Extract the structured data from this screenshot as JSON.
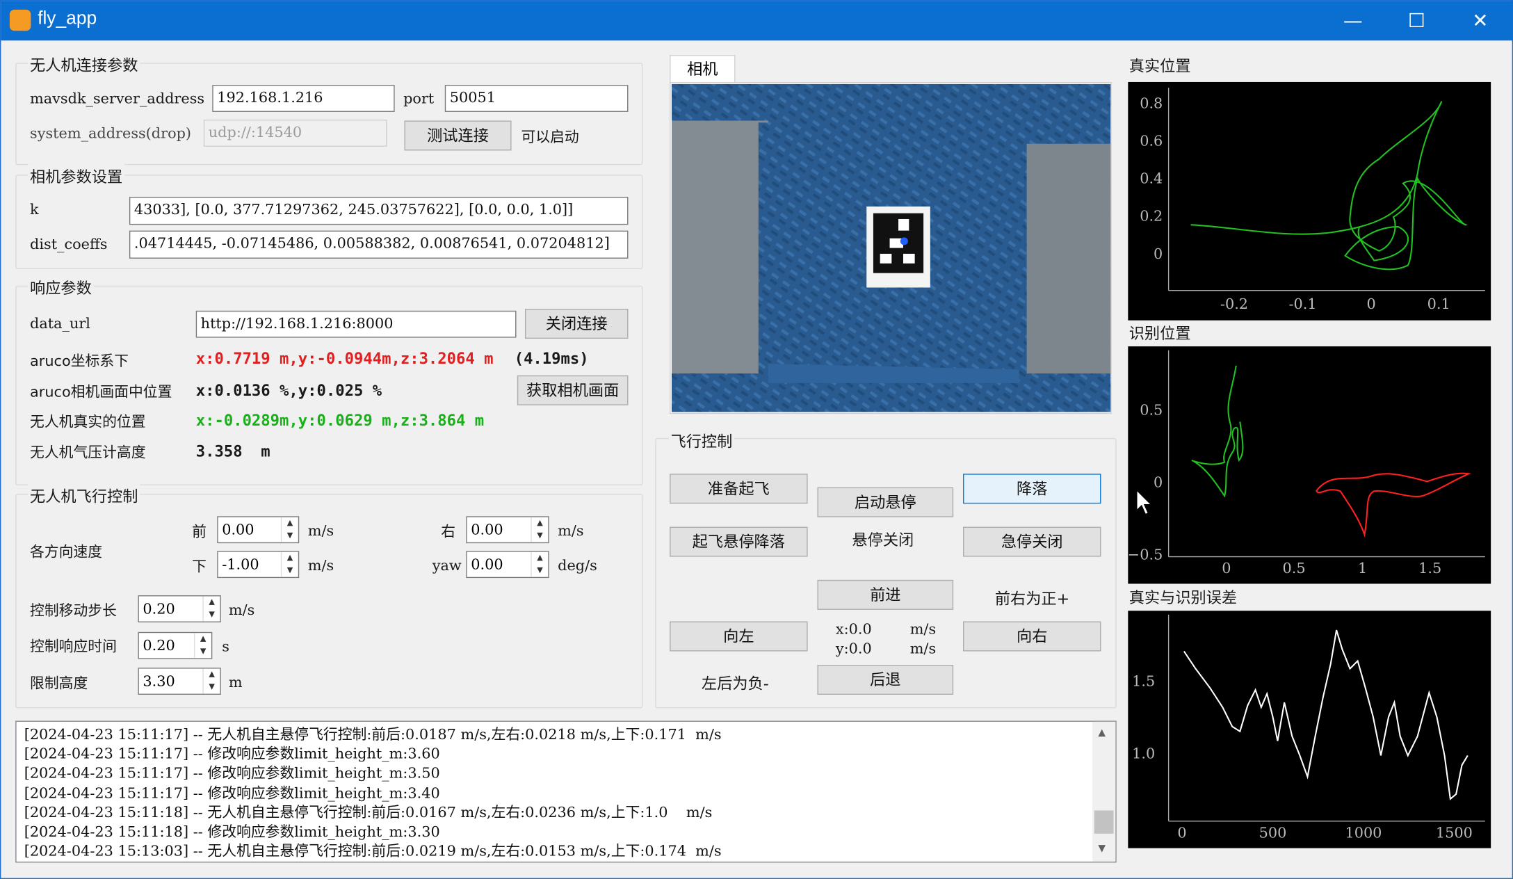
{
  "window": {
    "title": "fly_app",
    "minimize": "—",
    "maximize": "☐",
    "close": "✕"
  },
  "conn": {
    "group": "无人机连接参数",
    "server_label": "mavsdk_server_address",
    "server_value": "192.168.1.216",
    "port_label": "port",
    "port_value": "50051",
    "sys_label": "system_address(drop)",
    "sys_placeholder": "udp://:14540",
    "test_button": "测试连接",
    "status": "可以启动"
  },
  "camera_params": {
    "group": "相机参数设置",
    "k_label": "k",
    "k_value": "43033], [0.0, 377.71297362, 245.03757622], [0.0, 0.0, 1.0]]",
    "dist_label": "dist_coeffs",
    "dist_value": ".04714445, -0.07145486, 0.00588382, 0.00876541, 0.07204812]"
  },
  "response": {
    "group": "响应参数",
    "data_url_label": "data_url",
    "data_url_value": "http://192.168.1.216:8000",
    "close_button": "关闭连接",
    "aruco_label": "aruco坐标系下",
    "aruco_value": "x:0.7719 m,y:-0.0944m,z:3.2064 m",
    "aruco_time": "(4.19ms)",
    "aruco_cam_label": "aruco相机画面中位置",
    "aruco_cam_value": "x:0.0136 %,y:0.025  %",
    "get_image_button": "获取相机画面",
    "true_pos_label": "无人机真实的位置",
    "true_pos_value": "x:-0.0289m,y:0.0629 m,z:3.864 m",
    "baro_label": "无人机气压计高度",
    "baro_value": "3.358  m"
  },
  "flight": {
    "group": "无人机飞行控制",
    "speed_label": "各方向速度",
    "front_label": "前",
    "front_value": "0.00",
    "front_unit": "m/s",
    "right_label": "右",
    "right_value": "0.00",
    "right_unit": "m/s",
    "down_label": "下",
    "down_value": "-1.00",
    "down_unit": "m/s",
    "yaw_label": "yaw",
    "yaw_value": "0.00",
    "yaw_unit": "deg/s",
    "step_label": "控制移动步长",
    "step_value": "0.20",
    "step_unit": "m/s",
    "resp_time_label": "控制响应时间",
    "resp_time_value": "0.20",
    "resp_time_unit": "s",
    "height_label": "限制高度",
    "height_value": "3.30",
    "height_unit": "m"
  },
  "camera": {
    "tab": "相机"
  },
  "fly_ctrl": {
    "group": "飞行控制",
    "prepare": "准备起飞",
    "hover_start": "启动悬停",
    "land": "降落",
    "takeoff_hover_land": "起飞悬停降落",
    "hover_status": "悬停关闭",
    "estop": "急停关闭",
    "forward": "前进",
    "fr_note": "前右为正+",
    "left": "向左",
    "x_readout": "x:0.0",
    "x_unit": "m/s",
    "y_readout": "y:0.0",
    "y_unit": "m/s",
    "right": "向右",
    "lb_note": "左后为负-",
    "back": "后退"
  },
  "plots": {
    "true_title": "真实位置",
    "true_yticks": [
      "0.8",
      "0.6",
      "0.4",
      "0.2",
      "0"
    ],
    "true_xticks": [
      "-0.2",
      "-0.1",
      "0",
      "0.1"
    ],
    "ident_title": "识别位置",
    "ident_yticks": [
      "0.5",
      "0",
      "−0.5"
    ],
    "ident_xticks": [
      "0",
      "0.5",
      "1",
      "1.5"
    ],
    "err_title": "真实与识别误差",
    "err_yticks": [
      "1.5",
      "1.0"
    ],
    "err_xticks": [
      "0",
      "500",
      "1000",
      "1500"
    ],
    "colors": {
      "true": "#22c022",
      "ident_green": "#22c022",
      "ident_red": "#ff2020",
      "error": "#ffffff"
    }
  },
  "log": [
    "[2024-04-23 15:11:17] -- 无人机自主悬停飞行控制:前后:0.0187 m/s,左右:0.0218 m/s,上下:0.171  m/s",
    "[2024-04-23 15:11:17] -- 修改响应参数limit_height_m:3.60",
    "[2024-04-23 15:11:17] -- 修改响应参数limit_height_m:3.50",
    "[2024-04-23 15:11:17] -- 修改响应参数limit_height_m:3.40",
    "[2024-04-23 15:11:18] -- 无人机自主悬停飞行控制:前后:0.0167 m/s,左右:0.0236 m/s,上下:1.0    m/s",
    "[2024-04-23 15:11:18] -- 修改响应参数limit_height_m:3.30",
    "[2024-04-23 15:13:03] -- 无人机自主悬停飞行控制:前后:0.0219 m/s,左右:0.0153 m/s,上下:0.174  m/s"
  ]
}
